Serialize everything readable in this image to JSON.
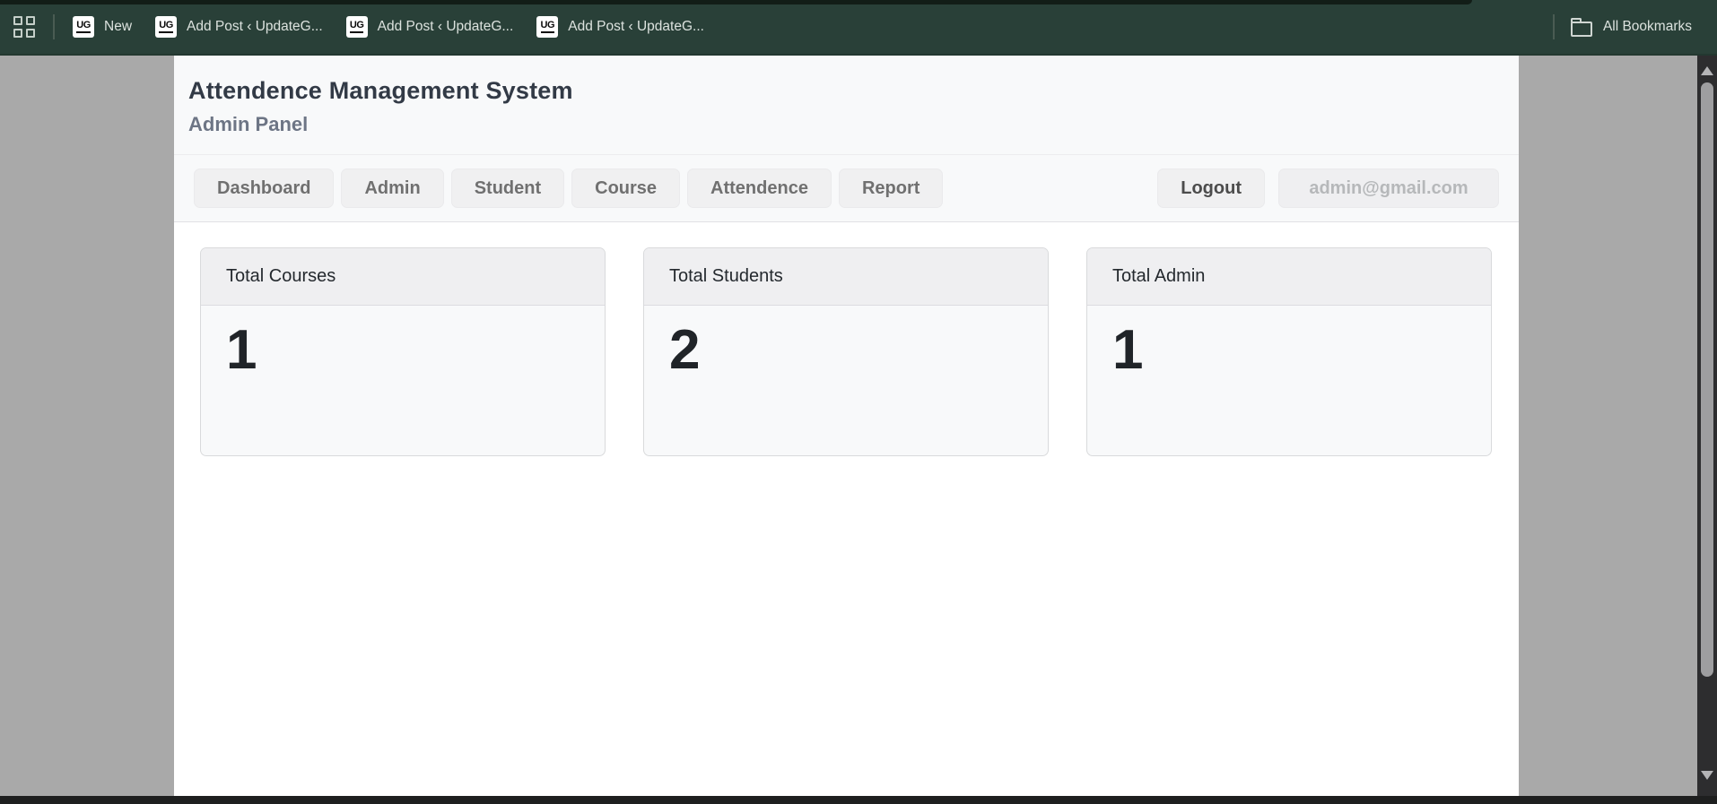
{
  "colors": {
    "bookmarks_bar_bg": "#294038",
    "top_strip": "#121d17",
    "desktop_gray": "#a9a9a9",
    "content_bg": "#ffffff",
    "header_band_bg": "#f8f9fa",
    "nav_button_bg": "#f0f0f1",
    "card_header_bg": "#efeff1",
    "card_body_bg": "#f8f9fa",
    "scrollbar_track": "#2d2d2f",
    "scrollbar_thumb": "#9e9ea0",
    "bottom_edge": "#1e1f1f"
  },
  "bookmarks_bar": {
    "items": [
      {
        "favicon_text": "UG",
        "label": "New"
      },
      {
        "favicon_text": "UG",
        "label": "Add Post ‹ UpdateG..."
      },
      {
        "favicon_text": "UG",
        "label": "Add Post ‹ UpdateG..."
      },
      {
        "favicon_text": "UG",
        "label": "Add Post ‹ UpdateG..."
      }
    ],
    "all_bookmarks_label": "All Bookmarks"
  },
  "page": {
    "title": "Attendence Management System",
    "subtitle": "Admin Panel",
    "nav": {
      "items": [
        {
          "label": "Dashboard"
        },
        {
          "label": "Admin"
        },
        {
          "label": "Student"
        },
        {
          "label": "Course"
        },
        {
          "label": "Attendence"
        },
        {
          "label": "Report"
        }
      ],
      "logout_label": "Logout",
      "user_email": "admin@gmail.com"
    },
    "cards": [
      {
        "title": "Total Courses",
        "value": "1"
      },
      {
        "title": "Total Students",
        "value": "2"
      },
      {
        "title": "Total Admin",
        "value": "1"
      }
    ]
  }
}
